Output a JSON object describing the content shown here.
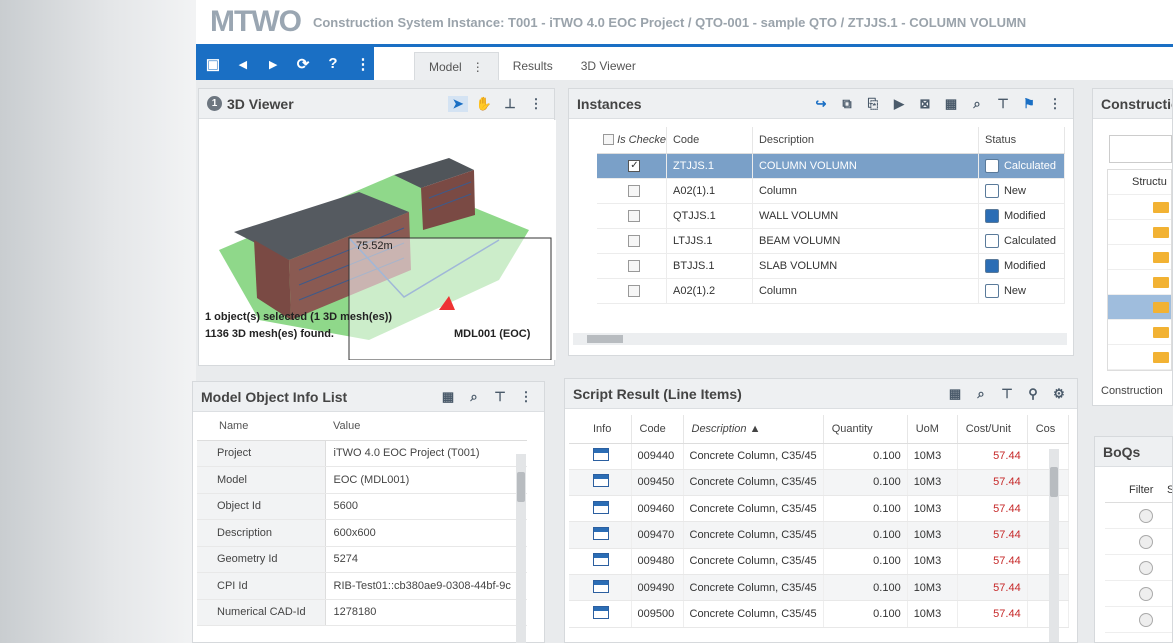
{
  "app": {
    "logo": "MTWO",
    "breadcrumb": "Construction System Instance: T001 - iTWO 4.0 EOC Project / QTO-001 - sample QTO / ZTJJS.1 - COLUMN VOLUMN"
  },
  "toolbar": {
    "icons": [
      "save-icon",
      "prev-icon",
      "next-icon",
      "refresh-icon",
      "help-icon",
      "more-icon"
    ],
    "tabs": [
      "Model",
      "Results",
      "3D Viewer"
    ],
    "active_tab": "Model",
    "tab_menu": "⋮"
  },
  "viewer": {
    "title": "3D Viewer",
    "number": "1",
    "distance": "75.52m",
    "selection_line1": "1 object(s) selected (1 3D mesh(es))",
    "selection_line2": "1136 3D mesh(es) found.",
    "model_label": "MDL001 (EOC)"
  },
  "instances": {
    "title": "Instances",
    "columns": [
      "Is Checke",
      "Code",
      "Description",
      "Status"
    ],
    "rows": [
      {
        "checked": true,
        "code": "ZTJJS.1",
        "description": "COLUMN VOLUMN",
        "status": "Calculated",
        "status_icon": "calculated-icon",
        "selected": true
      },
      {
        "checked": false,
        "code": "A02(1).1",
        "description": "Column",
        "status": "New",
        "status_icon": "new-icon"
      },
      {
        "checked": false,
        "code": "QTJJS.1",
        "description": "WALL VOLUMN",
        "status": "Modified",
        "status_icon": "modified-icon"
      },
      {
        "checked": false,
        "code": "LTJJS.1",
        "description": "BEAM VOLUMN",
        "status": "Calculated",
        "status_icon": "calculated-icon"
      },
      {
        "checked": false,
        "code": "BTJJS.1",
        "description": "SLAB VOLUMN",
        "status": "Modified",
        "status_icon": "modified-icon"
      },
      {
        "checked": false,
        "code": "A02(1).2",
        "description": "Column",
        "status": "New",
        "status_icon": "new-icon"
      }
    ]
  },
  "construction": {
    "title": "Construction",
    "column": "Structu",
    "footer": "Construction"
  },
  "model_info": {
    "title": "Model Object Info List",
    "columns": [
      "Name",
      "Value"
    ],
    "rows": [
      {
        "name": "Project",
        "value": "iTWO 4.0 EOC Project (T001)"
      },
      {
        "name": "Model",
        "value": "EOC (MDL001)"
      },
      {
        "name": "Object Id",
        "value": "5600"
      },
      {
        "name": "Description",
        "value": "600x600"
      },
      {
        "name": "Geometry Id",
        "value": "5274"
      },
      {
        "name": "CPI Id",
        "value": "RIB-Test01::cb380ae9-0308-44bf-9c"
      },
      {
        "name": "Numerical CAD-Id",
        "value": "1278180"
      }
    ]
  },
  "script_result": {
    "title": "Script Result (Line Items)",
    "columns": [
      "Info",
      "Code",
      "Description ▲",
      "Quantity",
      "UoM",
      "Cost/Unit",
      "Cos"
    ],
    "rows": [
      {
        "code": "009440",
        "description": "Concrete Column, C35/45",
        "quantity": "0.100",
        "uom": "10M3",
        "cost": "57.44"
      },
      {
        "code": "009450",
        "description": "Concrete Column, C35/45",
        "quantity": "0.100",
        "uom": "10M3",
        "cost": "57.44"
      },
      {
        "code": "009460",
        "description": "Concrete Column, C35/45",
        "quantity": "0.100",
        "uom": "10M3",
        "cost": "57.44"
      },
      {
        "code": "009470",
        "description": "Concrete Column, C35/45",
        "quantity": "0.100",
        "uom": "10M3",
        "cost": "57.44"
      },
      {
        "code": "009480",
        "description": "Concrete Column, C35/45",
        "quantity": "0.100",
        "uom": "10M3",
        "cost": "57.44"
      },
      {
        "code": "009490",
        "description": "Concrete Column, C35/45",
        "quantity": "0.100",
        "uom": "10M3",
        "cost": "57.44"
      },
      {
        "code": "009500",
        "description": "Concrete Column, C35/45",
        "quantity": "0.100",
        "uom": "10M3",
        "cost": "57.44"
      }
    ]
  },
  "boqs": {
    "title": "BoQs",
    "columns": [
      "Filter",
      "S"
    ]
  },
  "colors": {
    "accent": "#1a6fc4",
    "selected_row": "#7aa0c8",
    "cost_red": "#c62828"
  }
}
